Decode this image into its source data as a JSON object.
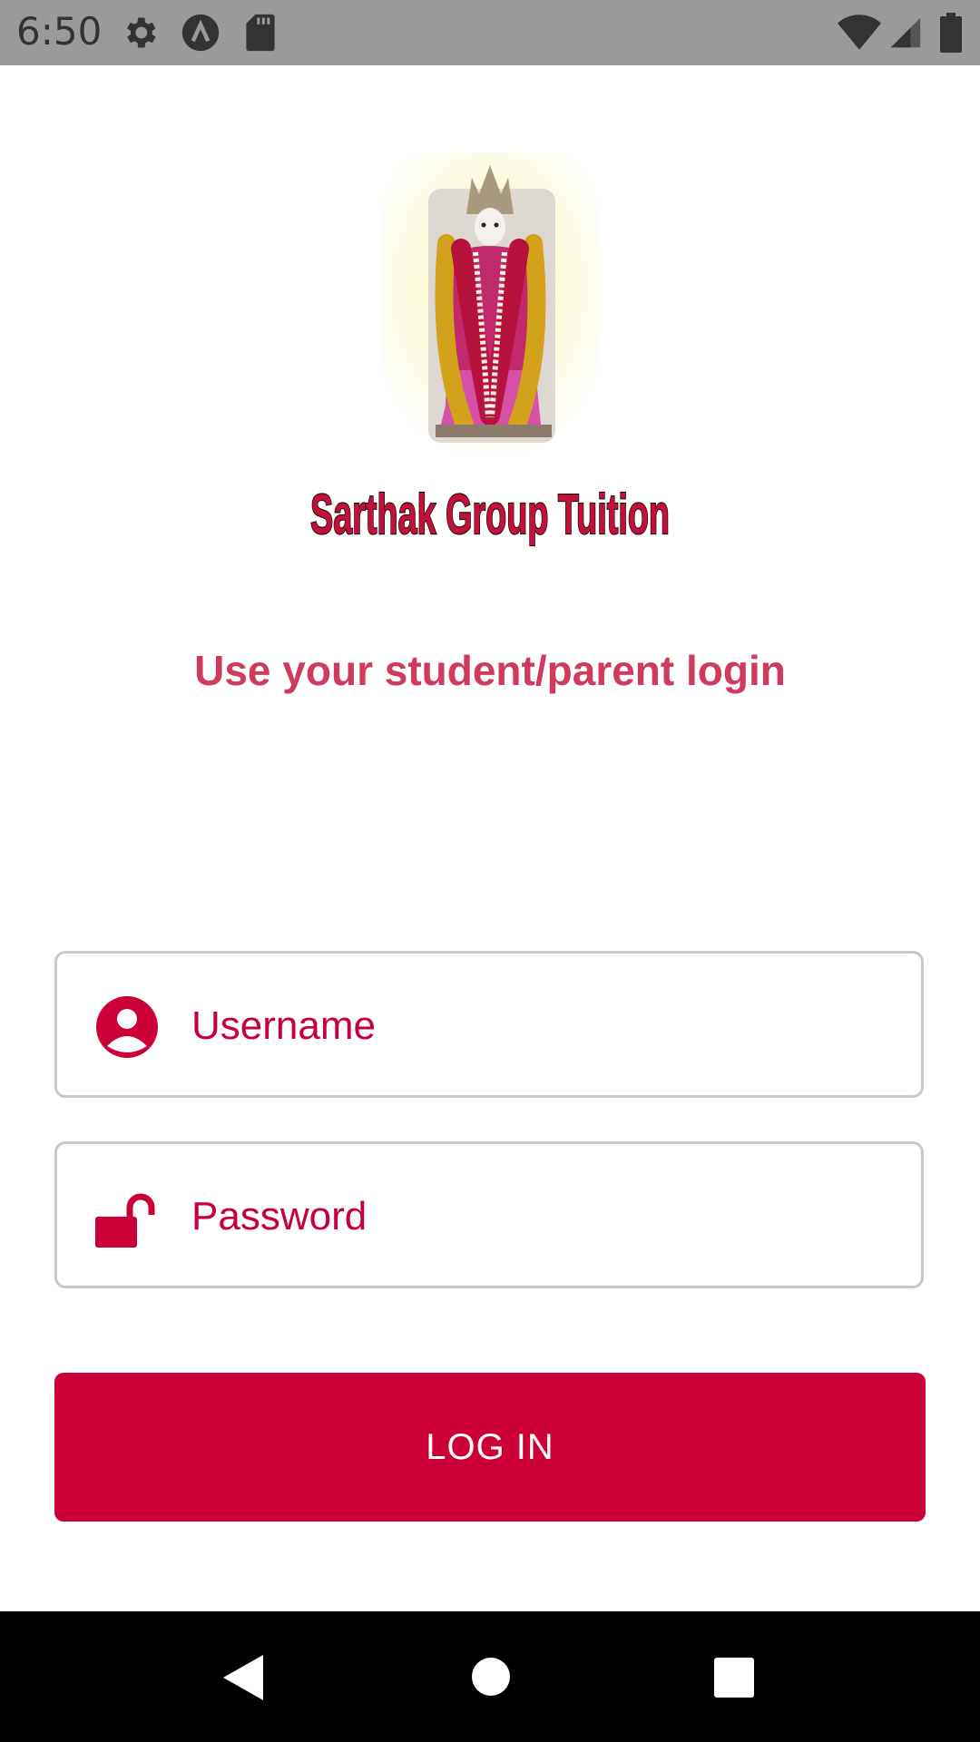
{
  "status_bar": {
    "time": "6:50",
    "icons": [
      "gear-icon",
      "vpn-icon",
      "sd-card-icon",
      "wifi-icon",
      "cell-signal-icon",
      "battery-icon"
    ]
  },
  "logo": {
    "brand_text": "Sarthak Group Tuition",
    "image": "deity-garland-image"
  },
  "subtitle": "Use your student/parent login",
  "form": {
    "username": {
      "placeholder": "Username",
      "value": "",
      "icon": "user-circle-icon"
    },
    "password": {
      "placeholder": "Password",
      "value": "",
      "icon": "unlock-icon"
    },
    "login_label": "LOG IN"
  },
  "nav_bar": {
    "buttons": [
      "back-icon",
      "home-icon",
      "recents-icon"
    ]
  },
  "colors": {
    "accent": "#cc0036",
    "subtitle": "#d03a5c",
    "status_bar": "#9a9a9a",
    "field_border": "#c8c8c8"
  }
}
